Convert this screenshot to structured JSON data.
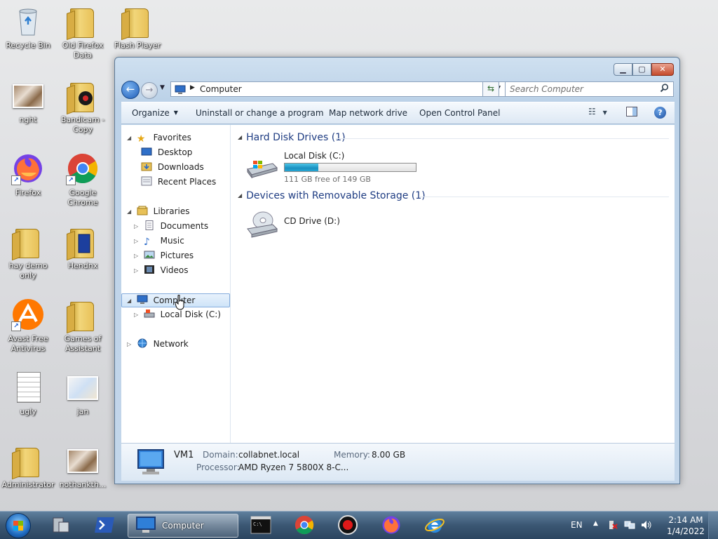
{
  "desktop": {
    "icons": [
      {
        "label": "Recycle Bin",
        "type": "recycle"
      },
      {
        "label": "Old Firefox Data",
        "type": "folder"
      },
      {
        "label": "Flash Player",
        "type": "folder"
      },
      {
        "label": "nght",
        "type": "photo"
      },
      {
        "label": "Bandicam - Copy",
        "type": "folder"
      },
      {
        "label": "Firefox",
        "type": "firefox"
      },
      {
        "label": "Google Chrome",
        "type": "chrome"
      },
      {
        "label": "hay demo only",
        "type": "folder"
      },
      {
        "label": "Hendnx",
        "type": "folder"
      },
      {
        "label": "Avast Free Antivirus",
        "type": "avast"
      },
      {
        "label": "Games of Assistant",
        "type": "folder"
      },
      {
        "label": "ugly",
        "type": "document"
      },
      {
        "label": "jan",
        "type": "photo"
      },
      {
        "label": "Administrator",
        "type": "folder"
      },
      {
        "label": "nothankth...",
        "type": "photo"
      }
    ]
  },
  "window": {
    "address": {
      "crumb": "Computer"
    },
    "search": {
      "placeholder": "Search Computer"
    },
    "toolbar": {
      "organize": "Organize",
      "uninstall": "Uninstall or change a program",
      "map_drive": "Map network drive",
      "control_panel": "Open Control Panel"
    },
    "nav": {
      "favorites": "Favorites",
      "desktop": "Desktop",
      "downloads": "Downloads",
      "recent": "Recent Places",
      "libraries": "Libraries",
      "documents": "Documents",
      "music": "Music",
      "pictures": "Pictures",
      "videos": "Videos",
      "computer": "Computer",
      "local_disk": "Local Disk (C:)",
      "network": "Network"
    },
    "groups": {
      "hdd": "Hard Disk Drives (1)",
      "removable": "Devices with Removable Storage (1)"
    },
    "drives": {
      "c": {
        "name": "Local Disk (C:)",
        "free": "111 GB free of 149 GB",
        "used_fraction": 0.255
      },
      "d": {
        "name": "CD Drive (D:)"
      }
    },
    "details": {
      "name": "VM1",
      "domain_label": "Domain:",
      "domain_value": "collabnet.local",
      "memory_label": "Memory:",
      "memory_value": "8.00 GB",
      "processor_label": "Processor:",
      "processor_value": "AMD Ryzen 7 5800X 8-C..."
    }
  },
  "taskbar": {
    "active_app": "Computer",
    "lang": "EN",
    "time": "2:14 AM",
    "date": "1/4/2022"
  },
  "colors": {
    "accent": "#1e3c82",
    "selection": "#cfe4f8",
    "disk_fill": "#27a6d3"
  }
}
